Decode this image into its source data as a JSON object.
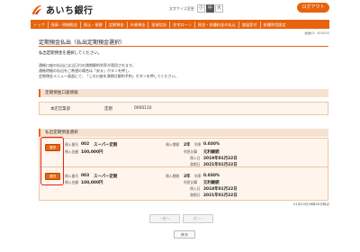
{
  "header": {
    "bank_name": "あいち銀行",
    "fontsize_label": "文字サイズ変更",
    "fontsize_options": [
      "小",
      "中",
      "大"
    ],
    "logout_label": "ログアウト"
  },
  "nav": {
    "items": [
      "トップ",
      "残高・明細照会",
      "振込・振替",
      "定期預金",
      "外貨預金",
      "投資信託",
      "住宅ローン",
      "税金・各種料金の払込",
      "諸届受付",
      "各種利用設定"
    ]
  },
  "screen_id": "画面ID：BT0005",
  "page": {
    "title": "定期預金払出（払出定期預金選択）",
    "subtitle": "払出定期預金を選択してください。",
    "instructions": [
      "通帳口座の払出には当日付の満期解約利率が適用されます。",
      "通帳明細の払出をご希望の場合は「戻る」ボタンを押し、",
      "定期預金メニュー画面にて、「この口座を満期日解約予約」ボタンを押してください。"
    ]
  },
  "account_section": {
    "heading": "定期預金口座情報",
    "branch": "本店営業部",
    "type": "定期",
    "number": "0000110"
  },
  "deposit_section": {
    "heading": "払出定期預金選択",
    "select_label": "選択",
    "labels": {
      "deposit_no": "預入番号",
      "amount": "預入金額",
      "period": "預入期間",
      "rate": "利率",
      "interest": "利息計算",
      "start": "預入日",
      "maturity": "満期日"
    },
    "items": [
      {
        "deposit_no": "002",
        "product": "スーパー定期",
        "amount": "100,000円",
        "period": "2年",
        "rate": "0.030%",
        "interest": "元利継続",
        "start": "2019年01月22日",
        "maturity": "2021年01月22日"
      },
      {
        "deposit_no": "003",
        "product": "スーパー定期",
        "amount": "100,000円",
        "period": "3年",
        "rate": "0.030%",
        "interest": "元利継続",
        "start": "2018年01月22日",
        "maturity": "2021年01月22日"
      }
    ]
  },
  "footnote": "01月20日08時30分時点",
  "pager": {
    "prev": "前へ",
    "next": "次へ"
  },
  "back_label": "戻る",
  "colors": {
    "accent": "#e8630e",
    "section_bg": "#f7e2cf",
    "card_bg": "#fff5ec",
    "highlight": "#e2231a"
  }
}
